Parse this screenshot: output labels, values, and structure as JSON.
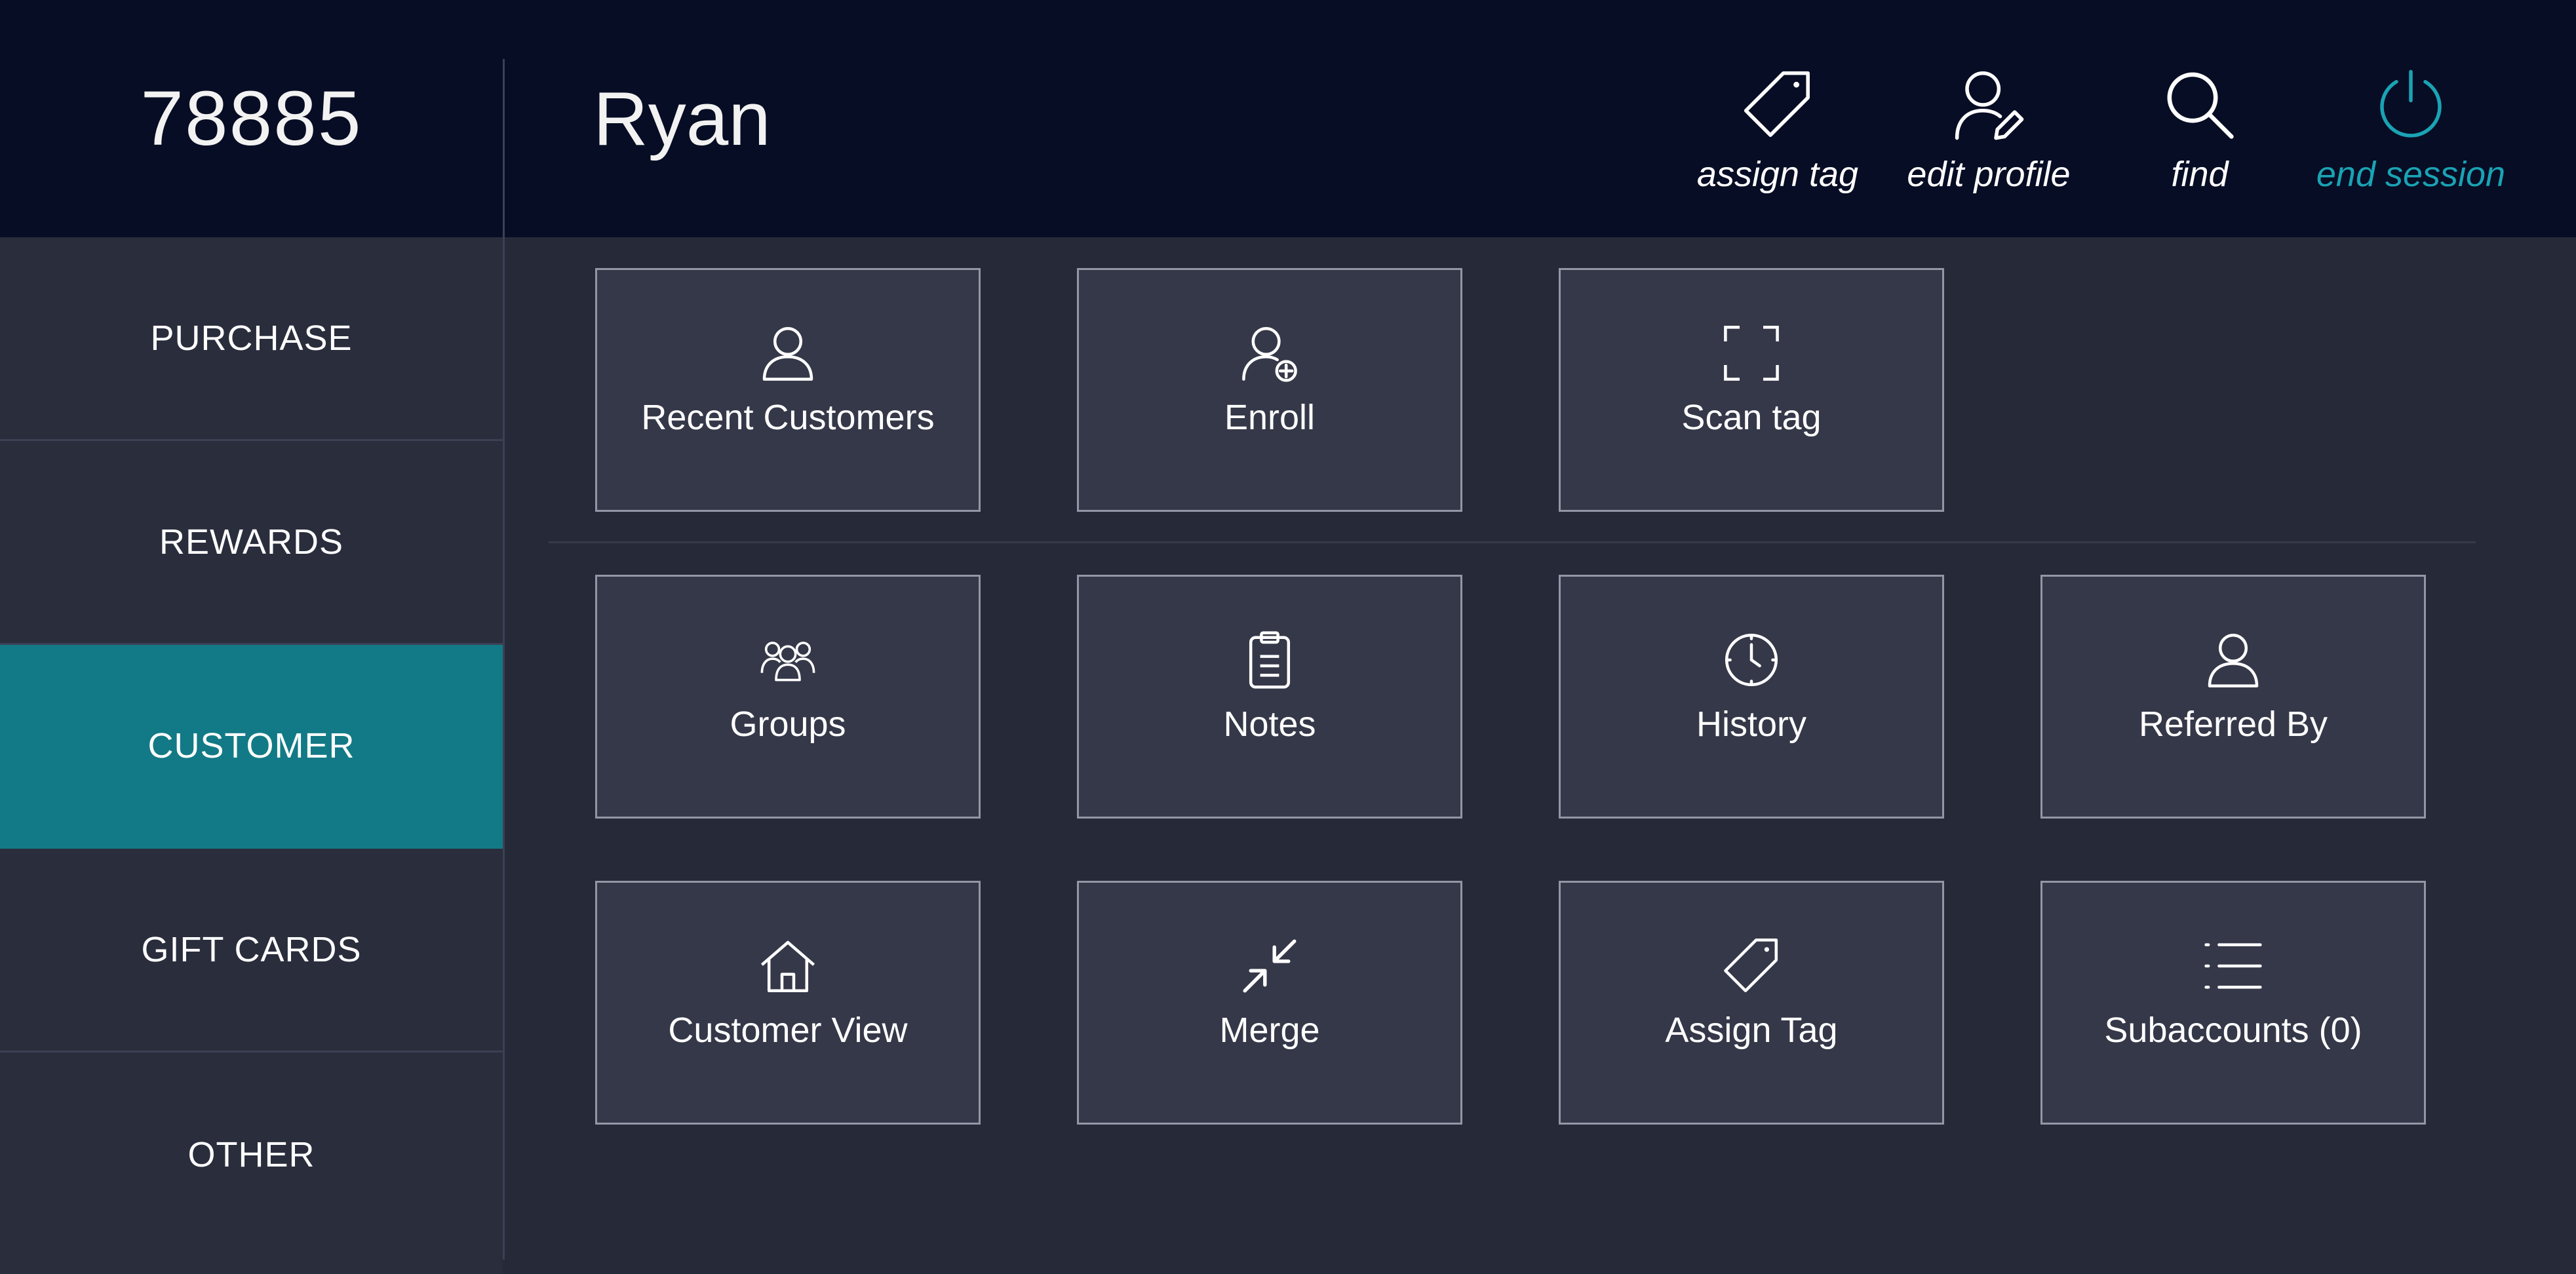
{
  "header": {
    "account_id": "78885",
    "customer_name": "Ryan",
    "actions": [
      {
        "label": "assign tag",
        "icon": "tag-icon"
      },
      {
        "label": "edit profile",
        "icon": "user-edit-icon"
      },
      {
        "label": "find",
        "icon": "search-icon"
      },
      {
        "label": "end session",
        "icon": "power-icon"
      }
    ]
  },
  "sidebar": {
    "items": [
      {
        "label": "PURCHASE"
      },
      {
        "label": "REWARDS"
      },
      {
        "label": "CUSTOMER",
        "active": true
      },
      {
        "label": "GIFT CARDS"
      },
      {
        "label": "OTHER"
      }
    ]
  },
  "tiles": {
    "row1": [
      {
        "label": "Recent Customers",
        "icon": "user-icon"
      },
      {
        "label": "Enroll",
        "icon": "user-add-icon"
      },
      {
        "label": "Scan tag",
        "icon": "scan-icon"
      }
    ],
    "row2": [
      {
        "label": "Groups",
        "icon": "group-icon"
      },
      {
        "label": "Notes",
        "icon": "clipboard-icon"
      },
      {
        "label": "History",
        "icon": "clock-icon"
      },
      {
        "label": "Referred By",
        "icon": "user-icon"
      }
    ],
    "row3": [
      {
        "label": "Customer View",
        "icon": "home-icon"
      },
      {
        "label": "Merge",
        "icon": "merge-arrows-icon"
      },
      {
        "label": "Assign Tag",
        "icon": "tag-icon"
      },
      {
        "label": "Subaccounts (0)",
        "icon": "list-icon"
      }
    ]
  },
  "colors": {
    "header_bg": "#070d24",
    "sidebar_bg": "#292d3c",
    "active_bg": "#127a86",
    "accent": "#1aa3b4",
    "tile_bg": "#353848",
    "tile_border": "#9297a6"
  }
}
